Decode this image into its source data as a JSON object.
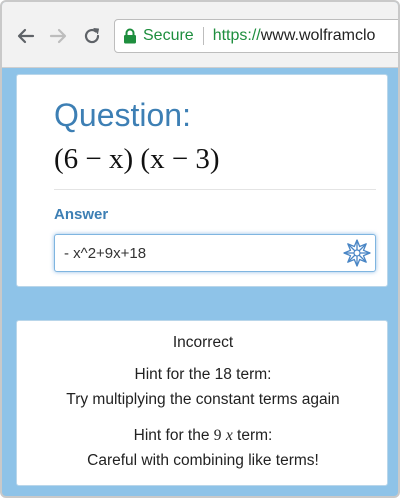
{
  "browser": {
    "secure_label": "Secure",
    "url_scheme": "https://",
    "url_host": "www.wolframclo",
    "secure_color": "#1e8e3e"
  },
  "question": {
    "title": "Question:",
    "expression": "(6 − x) (x − 3)"
  },
  "answer": {
    "label": "Answer",
    "value": "- x^2+9x+18",
    "submit_icon": "wolfram-star-icon"
  },
  "feedback": {
    "status": "Incorrect",
    "hint1_line1": "Hint for the 18 term:",
    "hint1_line2": "Try multiplying the constant terms again",
    "hint2_prefix": "Hint for the",
    "hint2_coef": "9",
    "hint2_var": "x",
    "hint2_suffix": "term:",
    "hint2_line2": "Careful with combining like terms!"
  },
  "colors": {
    "accent": "#3d7fb4",
    "page_background": "#8ec3e8"
  }
}
